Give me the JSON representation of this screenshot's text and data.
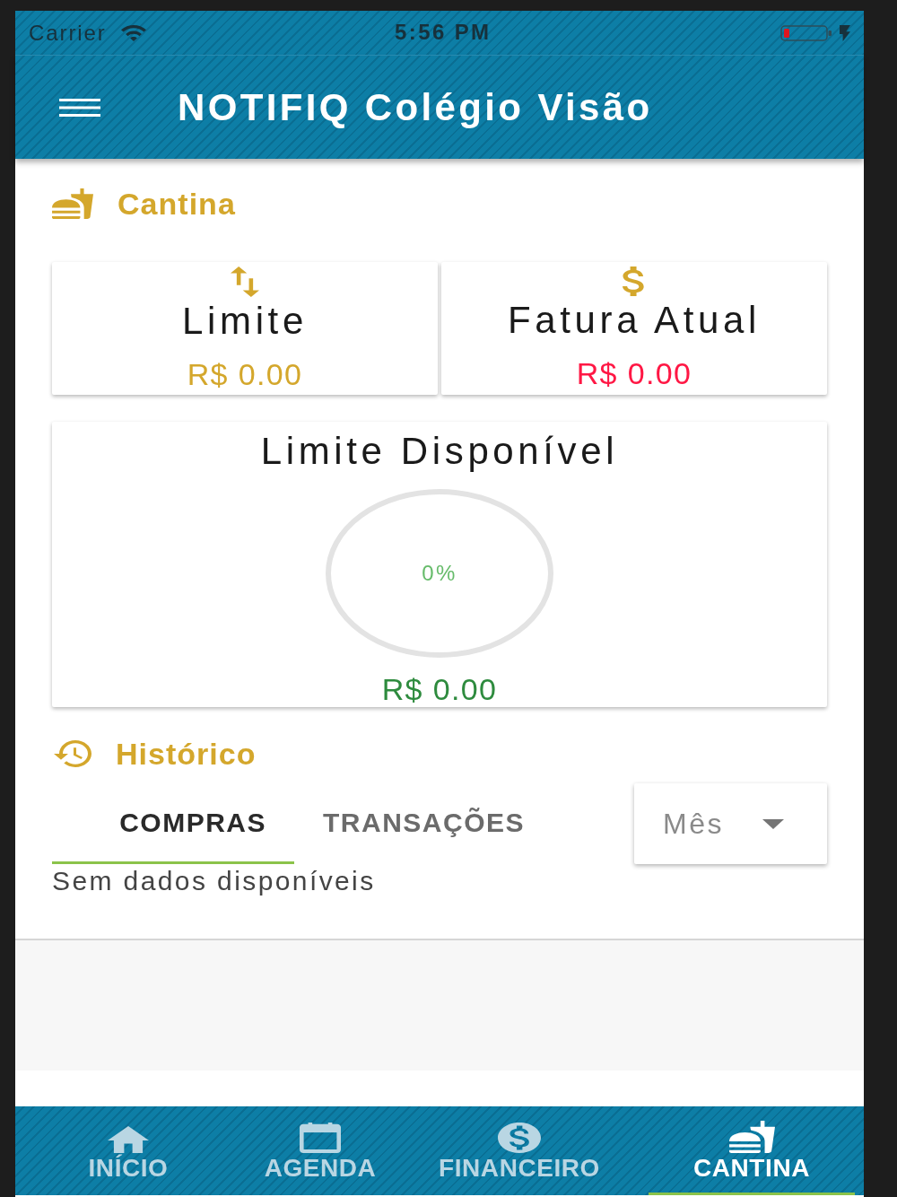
{
  "status_bar": {
    "carrier": "Carrier",
    "time": "5:56 PM"
  },
  "app_bar": {
    "title": "NOTIFIQ Colégio Visão"
  },
  "cantina": {
    "title": "Cantina",
    "cards": [
      {
        "kind": "limit",
        "title": "Limite",
        "value": "R$ 0.00"
      },
      {
        "kind": "invoice",
        "title": "Fatura Atual",
        "value": "R$ 0.00"
      }
    ],
    "available_limit": {
      "title": "Limite Disponível",
      "percent": "0%",
      "value": "R$ 0.00"
    }
  },
  "history": {
    "title": "Histórico",
    "tabs": [
      {
        "label": "COMPRAS",
        "selected": true
      },
      {
        "label": "TRANSAÇÕES",
        "selected": false
      }
    ],
    "period_select": {
      "value": "Mês"
    },
    "empty_message": "Sem dados disponíveis"
  },
  "bottom_nav": [
    {
      "kind": "home",
      "label": "INÍCIO",
      "selected": false
    },
    {
      "kind": "calendar",
      "label": "AGENDA",
      "selected": false
    },
    {
      "kind": "finance",
      "label": "FINANCEIRO",
      "selected": false
    },
    {
      "kind": "canteen",
      "label": "CANTINA",
      "selected": true
    }
  ]
}
